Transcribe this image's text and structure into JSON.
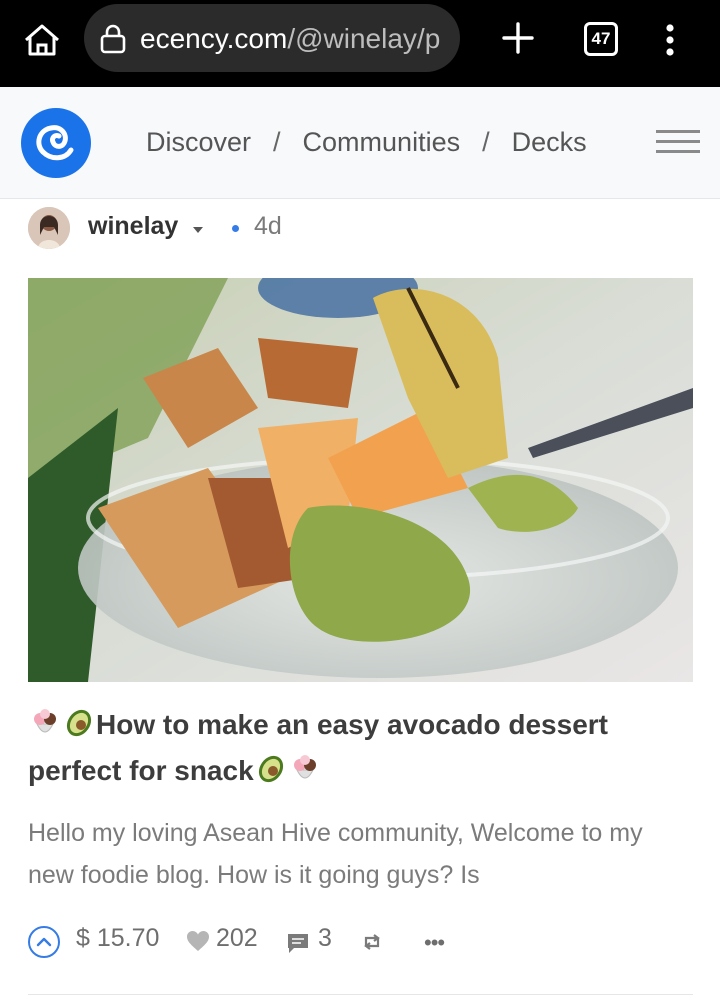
{
  "browser": {
    "url_host": "ecency.com",
    "url_path": "/@winelay/p",
    "tab_count": "47"
  },
  "header": {
    "nav": [
      "Discover",
      "Communities",
      "Decks"
    ],
    "separator": "/"
  },
  "post": {
    "author": "winelay",
    "age": "4d",
    "title": "How to make an easy avocado dessert perfect for snack",
    "summary": "Hello my loving Asean Hive community, Welcome to my new foodie blog. How is it going guys? Is",
    "payout": "$ 15.70",
    "likes": "202",
    "comments": "3"
  },
  "colors": {
    "accent": "#357ce6",
    "brand": "#1a73e8"
  }
}
